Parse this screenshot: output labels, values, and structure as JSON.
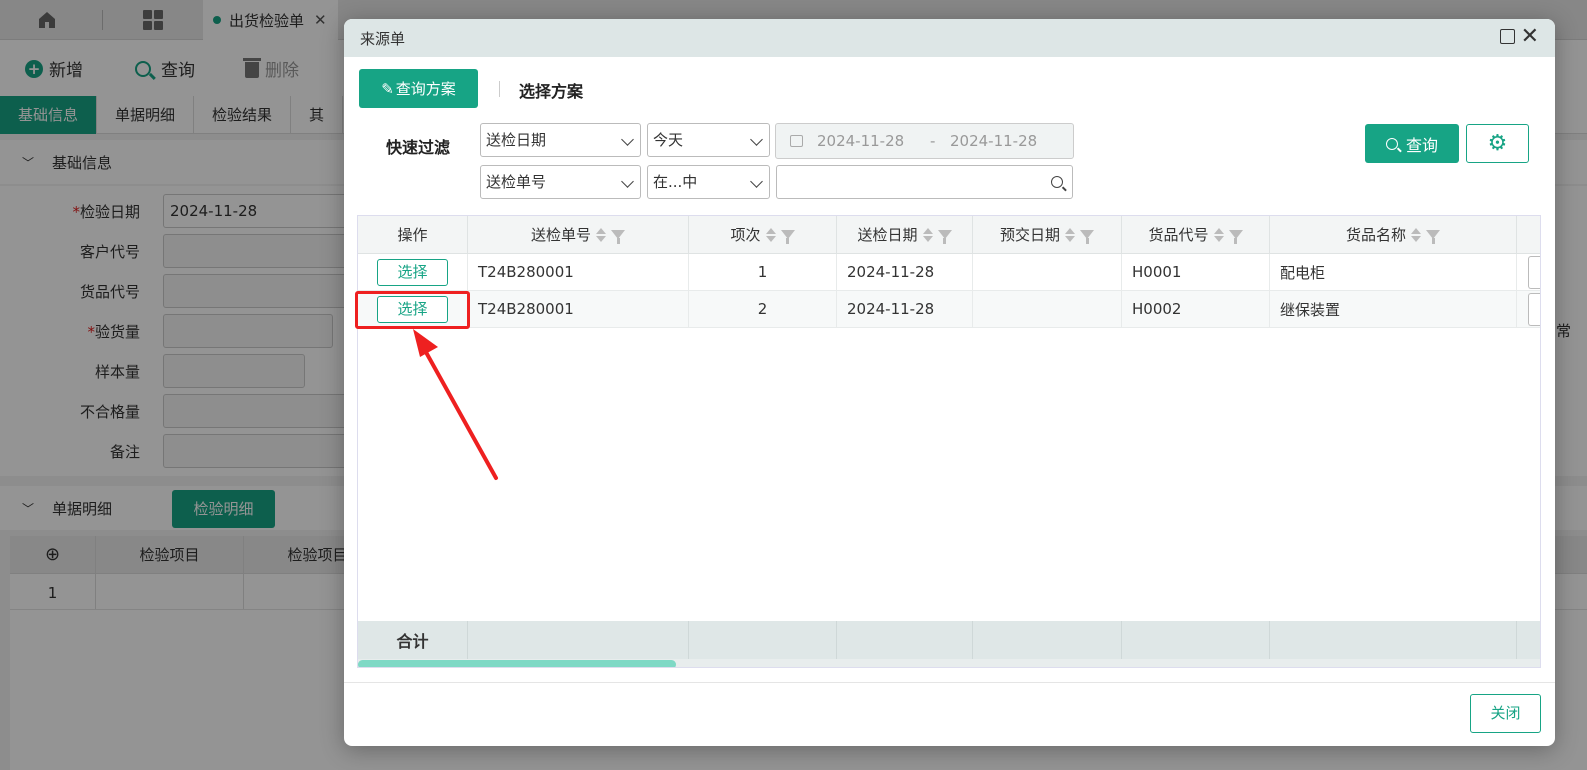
{
  "bg": {
    "doc_tab": "出货检验单",
    "toolbar": {
      "add": "新增",
      "query": "查询",
      "delete": "删除"
    },
    "form_tabs": [
      "基础信息",
      "单据明细",
      "检验结果",
      "其"
    ],
    "section_basic": "基础信息",
    "fields": [
      {
        "label": "检验日期",
        "required": "*",
        "value": "2024-11-28"
      },
      {
        "label": "客户代号",
        "required": "",
        "value": ""
      },
      {
        "label": "货品代号",
        "required": "",
        "value": ""
      },
      {
        "label": "验货量",
        "required": "*",
        "value": ""
      },
      {
        "label": "样本量",
        "required": "",
        "value": ""
      },
      {
        "label": "不合格量",
        "required": "",
        "value": ""
      },
      {
        "label": "备注",
        "required": "",
        "value": ""
      }
    ],
    "section_detail": "单据明细",
    "detail_btn": "检验明细",
    "detail_headers": [
      "检验项目",
      "检验项目"
    ],
    "detail_row_no": "1",
    "right_edge_text": "常"
  },
  "modal": {
    "title": "来源单",
    "scheme_btn": "查询方案",
    "scheme_label": "选择方案",
    "quick_filter": "快速过滤",
    "filter1_field": "送检日期",
    "filter1_op": "今天",
    "date_from": "2024-11-28",
    "date_sep": "-",
    "date_to": "2024-11-28",
    "filter2_field": "送检单号",
    "filter2_op": "在...中",
    "filter2_value": "",
    "query_btn": "查询",
    "columns": [
      "操作",
      "送检单号",
      "项次",
      "送检日期",
      "预交日期",
      "货品代号",
      "货品名称"
    ],
    "rows": [
      {
        "action": "选择",
        "no": "T24B280001",
        "seq": "1",
        "date": "2024-11-28",
        "due": "",
        "code": "H0001",
        "name": "配电柜"
      },
      {
        "action": "选择",
        "no": "T24B280001",
        "seq": "2",
        "date": "2024-11-28",
        "due": "",
        "code": "H0002",
        "name": "继保装置"
      }
    ],
    "total_label": "合计",
    "close_btn": "关闭"
  },
  "colors": {
    "accent": "#17a485",
    "annotation": "#ee2020"
  }
}
